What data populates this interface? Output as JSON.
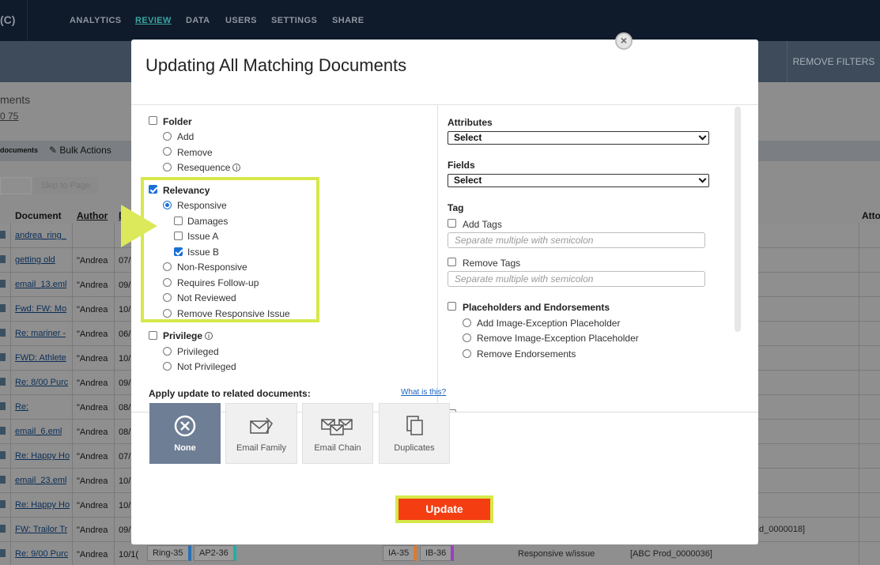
{
  "app": {
    "brand": "(C)",
    "nav": [
      "ANALYTICS",
      "REVIEW",
      "DATA",
      "USERS",
      "SETTINGS",
      "SHARE"
    ],
    "remove_filters": "REMOVE FILTERS",
    "docs_title": "ments",
    "docs_count": "0  75",
    "actions_docs": "documents",
    "bulk_actions": "Bulk Actions",
    "skip_to_page": "Skip to Page",
    "headers": {
      "document": "Document",
      "author": "Author",
      "d": "D",
      "att": "Atto"
    },
    "rows": [
      {
        "doc": "andrea_ring_",
        "author": "",
        "date": ""
      },
      {
        "doc": "getting old",
        "author": "\"Andrea",
        "date": "07/"
      },
      {
        "doc": "email_13.eml",
        "author": "\"Andrea",
        "date": "09/"
      },
      {
        "doc": "Fwd: FW: Mo",
        "author": "\"Andrea",
        "date": "10/"
      },
      {
        "doc": "Re: mariner -",
        "author": "\"Andrea",
        "date": "06/"
      },
      {
        "doc": "FWD: Athlete",
        "author": "\"Andrea",
        "date": "10/"
      },
      {
        "doc": "Re: 8/00 Purc",
        "author": "\"Andrea",
        "date": "09/"
      },
      {
        "doc": "Re:",
        "author": "\"Andrea",
        "date": "08/"
      },
      {
        "doc": "email_6.eml",
        "author": "\"Andrea",
        "date": "08/"
      },
      {
        "doc": "Re: Happy Ho",
        "author": "\"Andrea",
        "date": "07/"
      },
      {
        "doc": "email_23.eml",
        "author": "\"Andrea",
        "date": "10/"
      },
      {
        "doc": "Re: Happy Ho",
        "author": "\"Andrea",
        "date": "10/"
      },
      {
        "doc": "FW: Trailor Tr",
        "author": "\"Andrea",
        "date": "09/"
      },
      {
        "doc": "Re: 9/00 Purc",
        "author": "\"Andrea",
        "date": "10/1("
      }
    ],
    "bottom": {
      "tags": [
        "Ring-35",
        "AP2-36",
        "IA-35",
        "IB-36"
      ],
      "status": "Responsive w/issue",
      "bates_1": "[ABC Prod_0000036]",
      "bates_0": "d_0000018]"
    }
  },
  "modal": {
    "title": "Updating All Matching Documents",
    "close": "×",
    "folder": {
      "label": "Folder",
      "options": [
        "Add",
        "Remove",
        "Resequence"
      ]
    },
    "relevancy": {
      "label": "Relevancy",
      "responsive": "Responsive",
      "issues": [
        "Damages",
        "Issue A",
        "Issue B"
      ],
      "others": [
        "Non-Responsive",
        "Requires Follow-up",
        "Not Reviewed",
        "Remove Responsive Issue"
      ]
    },
    "privilege": {
      "label": "Privilege",
      "options": [
        "Privileged",
        "Not Privileged"
      ]
    },
    "attributes": {
      "label": "Attributes",
      "value": "Select"
    },
    "fields": {
      "label": "Fields",
      "value": "Select"
    },
    "tag": {
      "label": "Tag",
      "add_label": "Add Tags",
      "add_placeholder": "Separate multiple with semicolon",
      "remove_label": "Remove Tags",
      "remove_placeholder": "Separate multiple with semicolon"
    },
    "placeholders": {
      "label": "Placeholders and Endorsements",
      "options": [
        "Add Image-Exception Placeholder",
        "Remove Image-Exception Placeholder",
        "Remove Endorsements"
      ]
    },
    "apply": {
      "title": "Apply update to related documents:",
      "what": "What is this?",
      "options": [
        "None",
        "Email Family",
        "Email Chain",
        "Duplicates"
      ]
    },
    "update": "Update"
  },
  "colors": {
    "highlight": "#d6e84a",
    "update_button": "#f43d10",
    "selected_option": "#6e7e94",
    "nav_active": "#3aa7a3"
  }
}
